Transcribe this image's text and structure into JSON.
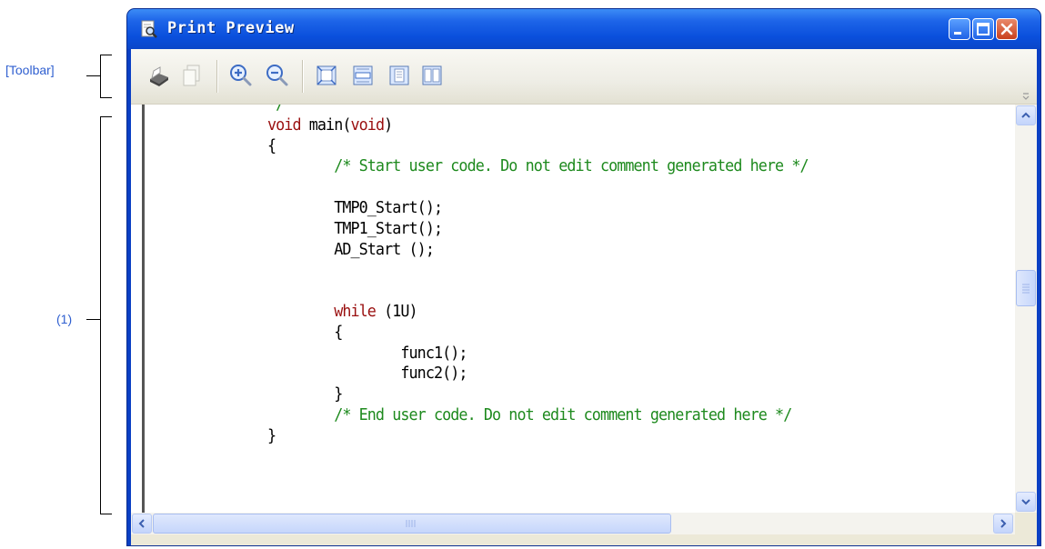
{
  "callouts": {
    "toolbar": "[Toolbar]",
    "pane": "(1)"
  },
  "window": {
    "title": "Print Preview",
    "icon": "print-preview-icon",
    "controls": [
      "minimize-icon",
      "maximize-icon",
      "close-icon"
    ]
  },
  "toolbar": {
    "buttons": [
      {
        "name": "print",
        "icon": "printer-icon"
      },
      {
        "name": "copy",
        "icon": "copy-icon",
        "disabled": true
      },
      {
        "name": "zoom-in",
        "icon": "zoom-in-icon"
      },
      {
        "name": "zoom-out",
        "icon": "zoom-out-icon"
      },
      {
        "name": "fit-whole-page",
        "icon": "fit-page-icon"
      },
      {
        "name": "fit-page-width",
        "icon": "fit-width-icon"
      },
      {
        "name": "one-page",
        "icon": "one-page-icon"
      },
      {
        "name": "two-pages",
        "icon": "two-pages-icon"
      }
    ]
  },
  "code_lines": [
    {
      "indent": "",
      "parts": [
        {
          "t": "*/",
          "c": "cm"
        }
      ]
    },
    {
      "indent": "",
      "parts": [
        {
          "t": "void",
          "c": "kw"
        },
        {
          "t": " main(",
          "c": ""
        },
        {
          "t": "void",
          "c": "kw"
        },
        {
          "t": ")",
          "c": ""
        }
      ]
    },
    {
      "indent": "",
      "parts": [
        {
          "t": "{",
          "c": ""
        }
      ]
    },
    {
      "indent": "        ",
      "parts": [
        {
          "t": "/* Start user code. Do not edit comment generated here */",
          "c": "cm"
        }
      ]
    },
    {
      "indent": "",
      "parts": []
    },
    {
      "indent": "        ",
      "parts": [
        {
          "t": "TMP0_Start();",
          "c": ""
        }
      ]
    },
    {
      "indent": "        ",
      "parts": [
        {
          "t": "TMP1_Start();",
          "c": ""
        }
      ]
    },
    {
      "indent": "        ",
      "parts": [
        {
          "t": "AD_Start ();",
          "c": ""
        }
      ]
    },
    {
      "indent": "",
      "parts": []
    },
    {
      "indent": "",
      "parts": []
    },
    {
      "indent": "        ",
      "parts": [
        {
          "t": "while",
          "c": "kw"
        },
        {
          "t": " (1U)",
          "c": ""
        }
      ]
    },
    {
      "indent": "        ",
      "parts": [
        {
          "t": "{",
          "c": ""
        }
      ]
    },
    {
      "indent": "                ",
      "parts": [
        {
          "t": "func1();",
          "c": ""
        }
      ]
    },
    {
      "indent": "                ",
      "parts": [
        {
          "t": "func2();",
          "c": ""
        }
      ]
    },
    {
      "indent": "        ",
      "parts": [
        {
          "t": "}",
          "c": ""
        }
      ]
    },
    {
      "indent": "        ",
      "parts": [
        {
          "t": "/* End user code. Do not edit comment generated here */",
          "c": "cm"
        }
      ]
    },
    {
      "indent": "",
      "parts": [
        {
          "t": "}",
          "c": ""
        }
      ]
    }
  ],
  "colors": {
    "keyword": "#9a1010",
    "comment": "#1e8a1e",
    "callout": "#2f5fd0",
    "titlebar": "#0a4fdc"
  }
}
